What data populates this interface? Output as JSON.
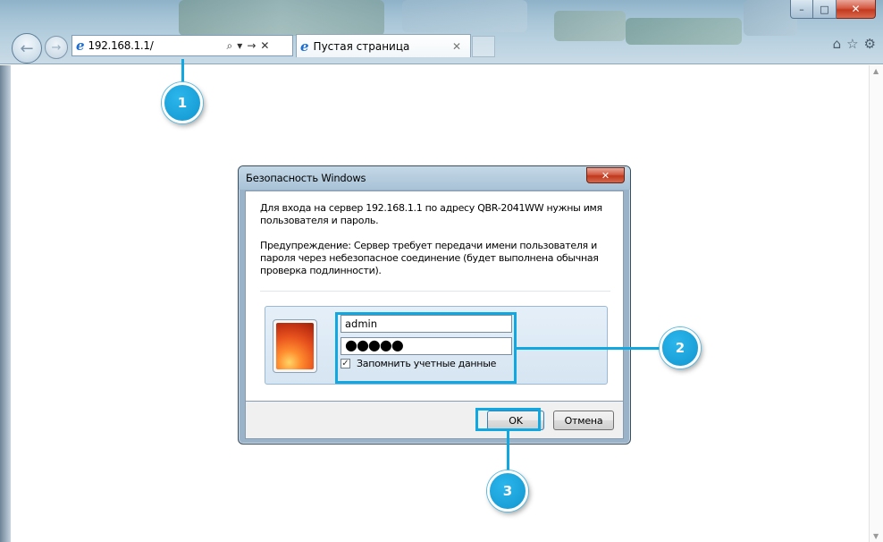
{
  "browser": {
    "address_url": "192.168.1.1/",
    "tab_title": "Пустая страница",
    "caption_buttons": {
      "minimize": "–",
      "maximize": "□",
      "close": "✕"
    },
    "icons": {
      "back": "back-arrow-icon",
      "forward": "forward-arrow-icon",
      "ie_logo": "ie-logo-icon",
      "search": "search-icon",
      "dropdown": "chevron-down-icon",
      "go": "go-arrow-icon",
      "stop": "stop-icon",
      "home": "home-icon",
      "favorites": "star-icon",
      "tools": "gear-icon"
    }
  },
  "dialog": {
    "title": "Безопасность Windows",
    "message_1": "Для входа на сервер 192.168.1.1 по адресу QBR-2041WW нужны имя пользователя и пароль.",
    "message_2": "Предупреждение: Сервер требует передачи имени пользователя и пароля через небезопасное соединение (будет выполнена обычная проверка подлинности).",
    "username_value": "admin",
    "password_value": "●●●●●",
    "remember_label": "Запомнить учетные данные",
    "remember_checked": true,
    "ok_label": "OK",
    "cancel_label": "Отмена"
  },
  "callouts": {
    "step1": "1",
    "step2": "2",
    "step3": "3"
  },
  "colors": {
    "callout": "#11a7e0",
    "close_red": "#c33a1e",
    "chrome_blue": "#a6c4d6"
  }
}
